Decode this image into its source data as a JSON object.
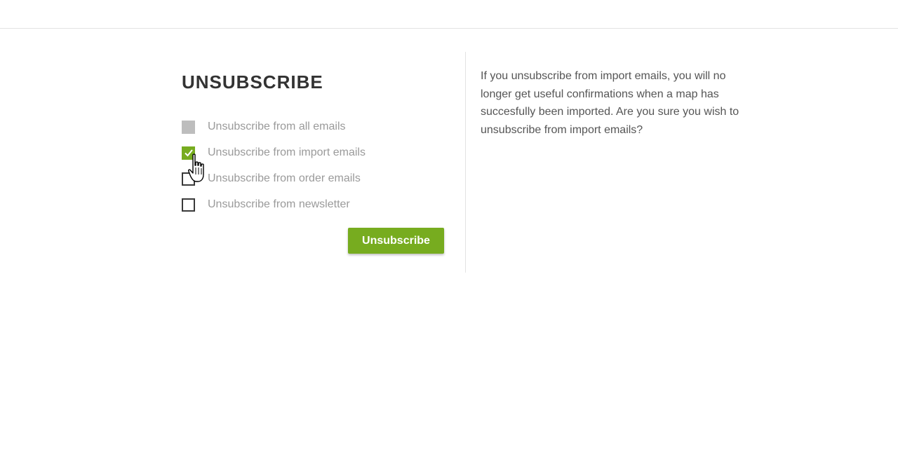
{
  "page": {
    "heading": "UNSUBSCRIBE",
    "accent_color": "#77ac1f"
  },
  "options": [
    {
      "label": "Unsubscribe from all emails",
      "state": "disabled"
    },
    {
      "label": "Unsubscribe from import emails",
      "state": "checked"
    },
    {
      "label": "Unsubscribe from order emails",
      "state": "unchecked"
    },
    {
      "label": "Unsubscribe from newsletter",
      "state": "unchecked"
    }
  ],
  "actions": {
    "submit_label": "Unsubscribe"
  },
  "info": {
    "text": "If you unsubscribe from import emails, you will no longer get useful confirmations when a map has succesfully been imported. Are you sure you wish to unsubscribe from import emails?"
  },
  "icons": {
    "checkmark": "check-icon",
    "cursor": "hand-pointer-icon"
  }
}
